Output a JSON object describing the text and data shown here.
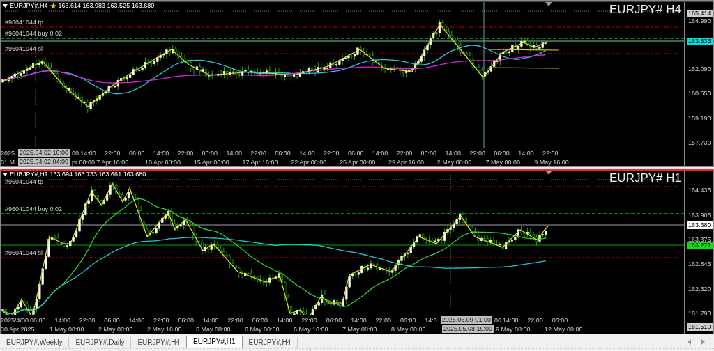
{
  "charts": [
    {
      "active": false,
      "symbol": "EURJPY#,H4",
      "ohlc": "163.614 163.983 163.525 163.680",
      "title": "EURJPY# H4",
      "order_labels": [
        {
          "kind": "tp",
          "text": "#96041044 tp"
        },
        {
          "kind": "entry",
          "text": "#96041044 buy 0.02"
        },
        {
          "kind": "sl",
          "text": "#96041044 sl"
        }
      ],
      "price_labels": [
        {
          "kind": "max",
          "text": "165.414"
        },
        {
          "kind": "tick",
          "text": "164.990"
        },
        {
          "kind": "ask",
          "text": "163.835"
        },
        {
          "kind": "tick",
          "text": "162.090"
        },
        {
          "kind": "tick",
          "text": "160.650"
        },
        {
          "kind": "tick",
          "text": "159.190"
        },
        {
          "kind": "tick",
          "text": "157.730"
        }
      ],
      "time_axis": {
        "upper": [
          {
            "kind": "part",
            "text": "2025"
          },
          {
            "kind": "cursor",
            "text": "2025.04.02 10:00"
          },
          {
            "kind": "part",
            "text": "00"
          },
          {
            "kind": "tick",
            "text": "14:00"
          },
          {
            "kind": "tick",
            "text": "22:00"
          },
          {
            "kind": "tick",
            "text": "06:00"
          },
          {
            "kind": "tick",
            "text": "14:00"
          },
          {
            "kind": "tick",
            "text": "22:00"
          },
          {
            "kind": "tick",
            "text": "06:00"
          },
          {
            "kind": "tick",
            "text": "14:00"
          },
          {
            "kind": "tick",
            "text": "22:00"
          },
          {
            "kind": "tick",
            "text": "06:00"
          },
          {
            "kind": "tick",
            "text": "14:00"
          },
          {
            "kind": "tick",
            "text": "22:00"
          },
          {
            "kind": "tick",
            "text": "06:00"
          },
          {
            "kind": "tick",
            "text": "14:00"
          },
          {
            "kind": "tick",
            "text": "22:00"
          },
          {
            "kind": "tick",
            "text": "06:00"
          },
          {
            "kind": "tick",
            "text": "14:00"
          },
          {
            "kind": "tick",
            "text": "22:00"
          },
          {
            "kind": "tick",
            "text": "06:00"
          },
          {
            "kind": "tick",
            "text": "14:00"
          },
          {
            "kind": "tick",
            "text": "22:00"
          }
        ],
        "lower": [
          {
            "kind": "part",
            "text": "31 M"
          },
          {
            "kind": "cursor",
            "text": "2025.04.02 04:00"
          },
          {
            "kind": "part",
            "text": "pr 00:00"
          },
          {
            "kind": "tick",
            "text": "7 Apr 16:00"
          },
          {
            "kind": "tick",
            "text": "10 Apr 08:00"
          },
          {
            "kind": "tick",
            "text": "15 Apr 00:00"
          },
          {
            "kind": "tick",
            "text": "17 Apr 16:00"
          },
          {
            "kind": "tick",
            "text": "22 Apr 08:00"
          },
          {
            "kind": "tick",
            "text": "25 Apr 00:00"
          },
          {
            "kind": "tick",
            "text": "29 Apr 16:00"
          },
          {
            "kind": "tick",
            "text": "2 May 08:00"
          },
          {
            "kind": "tick",
            "text": "7 May 00:00"
          },
          {
            "kind": "tick",
            "text": "9 May 16:00"
          }
        ]
      }
    },
    {
      "active": true,
      "symbol": "EURJPY#,H1",
      "ohlc": "163.694 163.733 163.661 163.680",
      "title": "EURJPY# H1",
      "order_labels": [
        {
          "kind": "tp",
          "text": "#96041044 tp"
        },
        {
          "kind": "entry",
          "text": "#96041044 buy 0.02"
        },
        {
          "kind": "sl",
          "text": "#96041044 sl"
        }
      ],
      "price_labels": [
        {
          "kind": "tick",
          "text": "164.435"
        },
        {
          "kind": "tick",
          "text": "163.905"
        },
        {
          "kind": "bid",
          "text": "163.680"
        },
        {
          "kind": "tick",
          "text": "163.375"
        },
        {
          "kind": "line",
          "text": "163.271"
        },
        {
          "kind": "tick",
          "text": "162.845"
        },
        {
          "kind": "tick",
          "text": "162.320"
        },
        {
          "kind": "tick",
          "text": "161.790"
        },
        {
          "kind": "min",
          "text": "161.510"
        }
      ],
      "time_axis": {
        "upper": [
          {
            "kind": "part",
            "text": "2025/4/30"
          },
          {
            "kind": "tick",
            "text": "06:00"
          },
          {
            "kind": "tick",
            "text": "14:00"
          },
          {
            "kind": "tick",
            "text": "22:00"
          },
          {
            "kind": "tick",
            "text": "06:00"
          },
          {
            "kind": "tick",
            "text": "14:00"
          },
          {
            "kind": "tick",
            "text": "22:00"
          },
          {
            "kind": "tick",
            "text": "06:00"
          },
          {
            "kind": "tick",
            "text": "14:00"
          },
          {
            "kind": "tick",
            "text": "22:00"
          },
          {
            "kind": "tick",
            "text": "06:00"
          },
          {
            "kind": "tick",
            "text": "14:00"
          },
          {
            "kind": "tick",
            "text": "22:00"
          },
          {
            "kind": "tick",
            "text": "06:00"
          },
          {
            "kind": "tick",
            "text": "14:00"
          },
          {
            "kind": "tick",
            "text": "22:00"
          },
          {
            "kind": "tick",
            "text": "06:00"
          },
          {
            "kind": "part",
            "text": "14:0"
          },
          {
            "kind": "cursor",
            "text": "2025.05.09 01:00"
          },
          {
            "kind": "part",
            "text": "00"
          },
          {
            "kind": "tick",
            "text": "14:00"
          },
          {
            "kind": "tick",
            "text": "22:00"
          },
          {
            "kind": "tick",
            "text": "06:00"
          }
        ],
        "lower": [
          {
            "kind": "tick",
            "text": "30 Apr 2025"
          },
          {
            "kind": "tick",
            "text": "1 May 08:00"
          },
          {
            "kind": "tick",
            "text": "2 May 00:00"
          },
          {
            "kind": "tick",
            "text": "2 May 16:00"
          },
          {
            "kind": "tick",
            "text": "5 May 08:00"
          },
          {
            "kind": "tick",
            "text": "6 May 00:00"
          },
          {
            "kind": "tick",
            "text": "6 May 16:00"
          },
          {
            "kind": "tick",
            "text": "7 May 08:00"
          },
          {
            "kind": "tick",
            "text": "8 May 00:00"
          },
          {
            "kind": "cursor",
            "text": "2025.05.08 19:00"
          },
          {
            "kind": "tick",
            "text": "9 May 08:00"
          },
          {
            "kind": "tick",
            "text": "12 May 00:00"
          }
        ]
      }
    }
  ],
  "tabs": [
    {
      "label": "EURJPY#,Weekly",
      "selected": false
    },
    {
      "label": "EURJPY#,Daily",
      "selected": false
    },
    {
      "label": "EURJPY#,H4",
      "selected": false
    },
    {
      "label": "EURJPY#,H1",
      "selected": true
    },
    {
      "label": "EURJPY#,H4",
      "selected": false
    }
  ]
}
